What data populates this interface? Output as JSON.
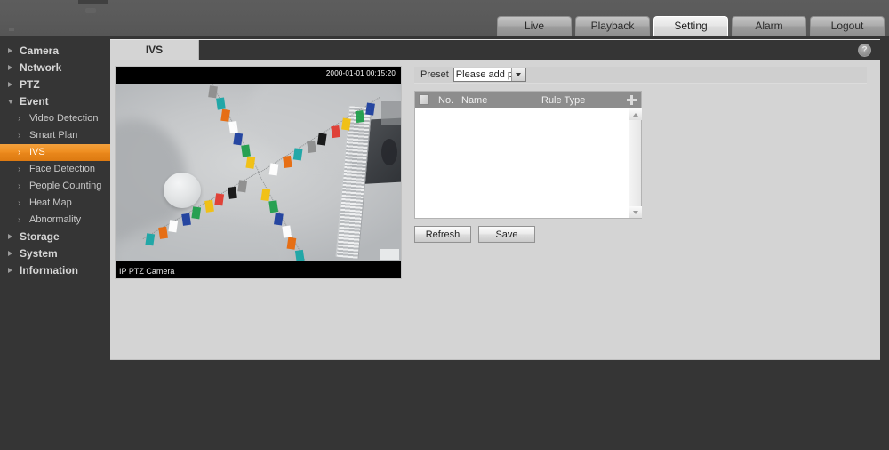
{
  "header": {
    "nav": [
      {
        "label": "Live",
        "active": false
      },
      {
        "label": "Playback",
        "active": false
      },
      {
        "label": "Setting",
        "active": true
      },
      {
        "label": "Alarm",
        "active": false
      },
      {
        "label": "Logout",
        "active": false
      }
    ]
  },
  "sidebar": {
    "groups": [
      {
        "label": "Camera",
        "expanded": false
      },
      {
        "label": "Network",
        "expanded": false
      },
      {
        "label": "PTZ",
        "expanded": false
      },
      {
        "label": "Event",
        "expanded": true
      },
      {
        "label": "Storage",
        "expanded": false
      },
      {
        "label": "System",
        "expanded": false
      },
      {
        "label": "Information",
        "expanded": false
      }
    ],
    "event_items": [
      {
        "label": "Video Detection",
        "active": false
      },
      {
        "label": "Smart Plan",
        "active": false
      },
      {
        "label": "IVS",
        "active": true
      },
      {
        "label": "Face Detection",
        "active": false
      },
      {
        "label": "People Counting",
        "active": false
      },
      {
        "label": "Heat Map",
        "active": false
      },
      {
        "label": "Abnormality",
        "active": false
      }
    ]
  },
  "main": {
    "tab_label": "IVS",
    "help_glyph": "?",
    "preset": {
      "label": "Preset",
      "selected": "Please add preset",
      "options": [
        "Please add preset"
      ]
    },
    "table": {
      "headers": {
        "no": "No.",
        "name": "Name",
        "rule_type": "Rule Type"
      },
      "add_icon": "plus-icon",
      "rows": []
    },
    "buttons": {
      "refresh": "Refresh",
      "save": "Save"
    }
  },
  "video": {
    "osd_time": "2000-01-01 00:15:20",
    "osd_name": "IP PTZ Camera",
    "scene_description": "ceiling view with colored bunting flag strings radiating from a dome camera"
  },
  "colors": {
    "accent_orange": "#ef8f22",
    "panel_gray": "#d4d4d4",
    "chrome_dark": "#353535",
    "header_gray": "#5a5a5a",
    "table_header": "#8d8d8d"
  }
}
